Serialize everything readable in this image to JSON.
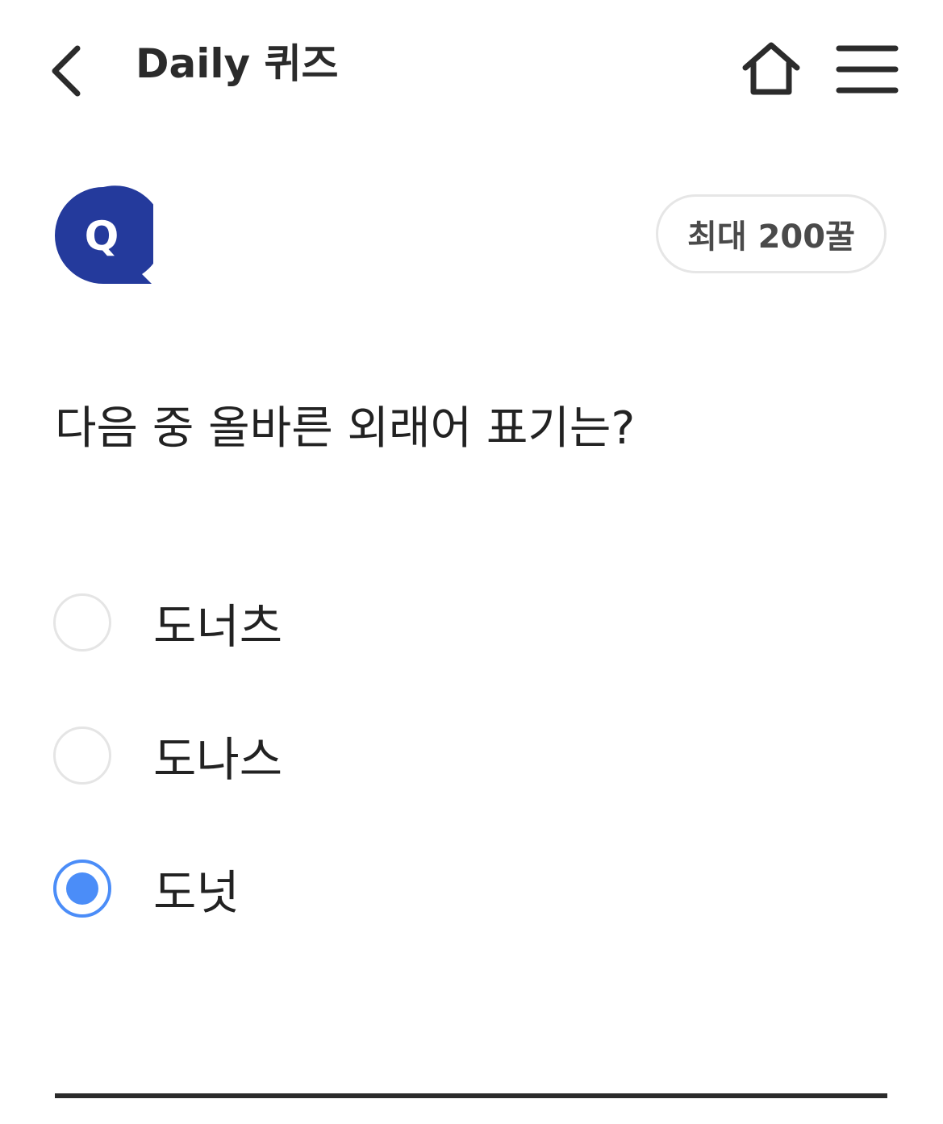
{
  "header": {
    "title": "Daily 퀴즈",
    "back_icon": "chevron-left-icon",
    "home_icon": "home-icon",
    "menu_icon": "hamburger-menu-icon"
  },
  "quiz": {
    "badge_letter": "Q",
    "reward": "최대 200꿀",
    "question": "다음 중 올바른 외래어 표기는?",
    "options": [
      {
        "label": "도너츠",
        "selected": false
      },
      {
        "label": "도나스",
        "selected": false
      },
      {
        "label": "도넛",
        "selected": true
      }
    ]
  },
  "colors": {
    "accent": "#4b8df8",
    "badge": "#243a9c",
    "text": "#222222",
    "pill_border": "#e6e6e6"
  }
}
